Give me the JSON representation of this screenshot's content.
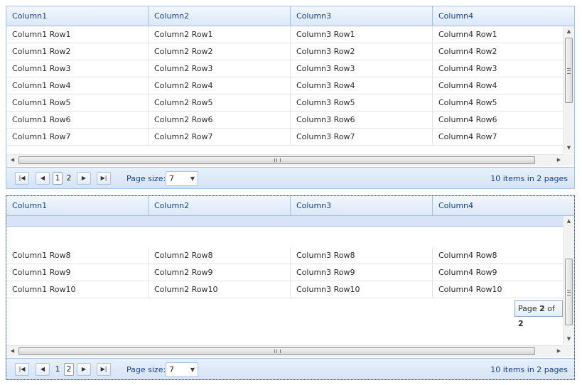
{
  "columns": [
    "Column1",
    "Column2",
    "Column3",
    "Column4"
  ],
  "grid1": {
    "rows": [
      [
        "Column1 Row1",
        "Column2 Row1",
        "Column3 Row1",
        "Column4 Row1"
      ],
      [
        "Column1 Row2",
        "Column2 Row2",
        "Column3 Row2",
        "Column4 Row2"
      ],
      [
        "Column1 Row3",
        "Column2 Row3",
        "Column3 Row3",
        "Column4 Row3"
      ],
      [
        "Column1 Row4",
        "Column2 Row4",
        "Column3 Row4",
        "Column4 Row4"
      ],
      [
        "Column1 Row5",
        "Column2 Row5",
        "Column3 Row5",
        "Column4 Row5"
      ],
      [
        "Column1 Row6",
        "Column2 Row6",
        "Column3 Row6",
        "Column4 Row6"
      ],
      [
        "Column1 Row7",
        "Column2 Row7",
        "Column3 Row7",
        "Column4 Row7"
      ]
    ],
    "pager": {
      "pages": [
        "1",
        "2"
      ],
      "current": "1",
      "page_size_label": "Page size:",
      "page_size": "7",
      "info": "10 items in 2 pages"
    }
  },
  "grid2": {
    "rows": [
      [
        "Column1 Row8",
        "Column2 Row8",
        "Column3 Row8",
        "Column4 Row8"
      ],
      [
        "Column1 Row9",
        "Column2 Row9",
        "Column3 Row9",
        "Column4 Row9"
      ],
      [
        "Column1 Row10",
        "Column2 Row10",
        "Column3 Row10",
        "Column4 Row10"
      ]
    ],
    "tooltip": {
      "prefix": "Page ",
      "page": "2",
      "middle": " of ",
      "total": "2"
    },
    "pager": {
      "pages": [
        "1",
        "2"
      ],
      "current": "2",
      "page_size_label": "Page size:",
      "page_size": "7",
      "info": "10 items in 2 pages"
    }
  },
  "icons": {
    "first": "first-page-icon",
    "prev": "prev-page-icon",
    "next": "next-page-icon",
    "last": "last-page-icon"
  }
}
